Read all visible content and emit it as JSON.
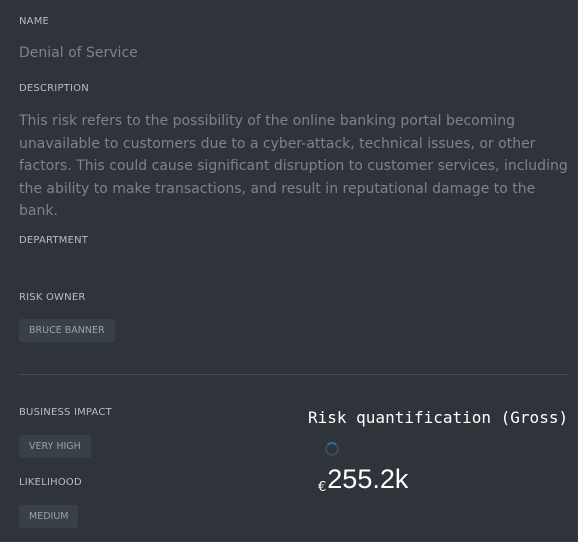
{
  "fields": {
    "name_label": "NAME",
    "name_value": "Denial of Service",
    "description_label": "DESCRIPTION",
    "description_value": "This risk refers to the possibility of the online banking portal becoming unavailable to customers due to a cyber-attack, technical issues, or other factors. This could cause significant disruption to customer services, including the ability to make transactions, and result in reputational damage to the bank.",
    "department_label": "DEPARTMENT",
    "risk_owner_label": "RISK OWNER",
    "risk_owner_value": "BRUCE BANNER",
    "business_impact_label": "BUSINESS IMPACT",
    "business_impact_value": "VERY HIGH",
    "likelihood_label": "LIKELIHOOD",
    "likelihood_value": "MEDIUM"
  },
  "quantification": {
    "title": "Risk quantification (Gross)",
    "currency_symbol": "€",
    "amount": "255.2k"
  },
  "icons": {
    "loading": "spinner-icon"
  },
  "colors": {
    "background": "#2f343b",
    "chip_background": "#3a4048",
    "muted_text": "#7c838e",
    "label_text": "#b6bcc6",
    "accent_text": "#ffffff"
  }
}
